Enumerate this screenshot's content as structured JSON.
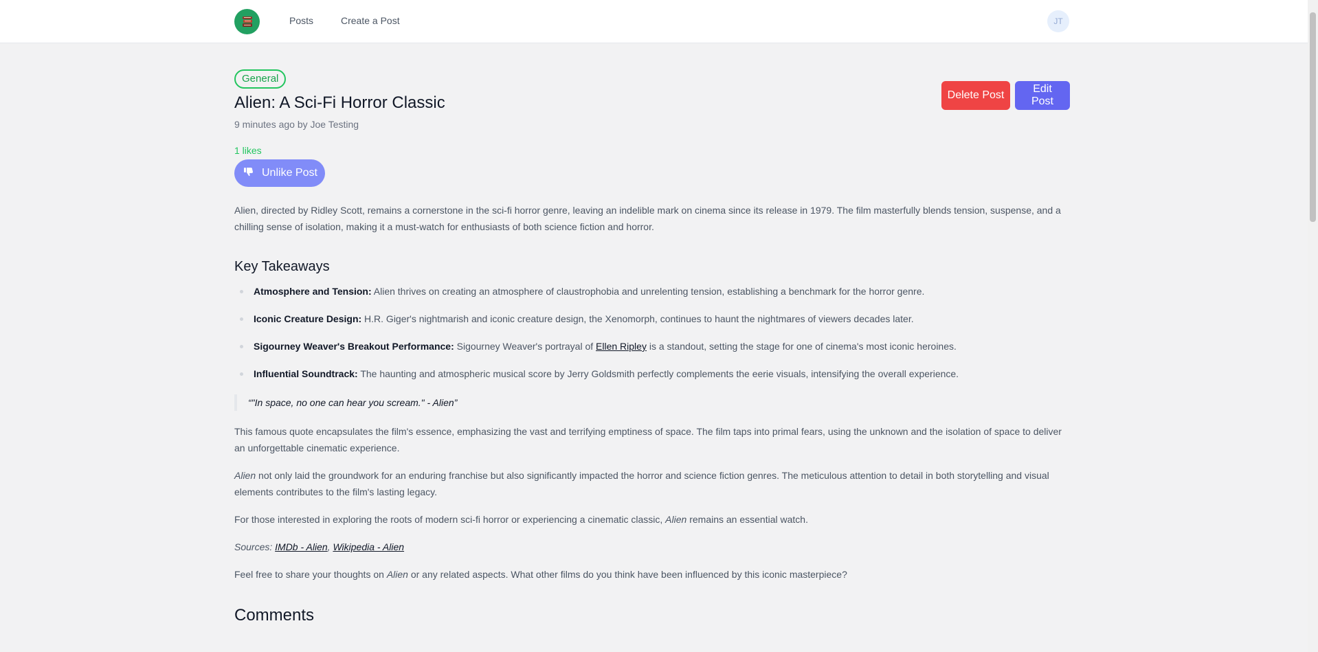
{
  "nav": {
    "logo_icon": "book-stack-icon",
    "links": [
      "Posts",
      "Create a Post"
    ],
    "avatar_initials": "JT"
  },
  "post": {
    "category": "General",
    "title": "Alien: A Sci-Fi Horror Classic",
    "meta": "9 minutes ago by Joe Testing",
    "delete_label": "Delete Post",
    "edit_label": "Edit Post",
    "likes": "1 likes",
    "unlike_label": "Unlike Post"
  },
  "article": {
    "intro": "Alien, directed by Ridley Scott, remains a cornerstone in the sci-fi horror genre, leaving an indelible mark on cinema since its release in 1979. The film masterfully blends tension, suspense, and a chilling sense of isolation, making it a must-watch for enthusiasts of both science fiction and horror.",
    "takeaways_heading": "Key Takeaways",
    "takeaways": [
      {
        "term": "Atmosphere and Tension:",
        "text": " Alien thrives on creating an atmosphere of claustrophobia and unrelenting tension, establishing a benchmark for the horror genre."
      },
      {
        "term": "Iconic Creature Design:",
        "text": " H.R. Giger's nightmarish and iconic creature design, the Xenomorph, continues to haunt the nightmares of viewers decades later."
      },
      {
        "term": "Sigourney Weaver's Breakout Performance:",
        "text_before": " Sigourney Weaver's portrayal of ",
        "link": "Ellen Ripley",
        "text_after": " is a standout, setting the stage for one of cinema's most iconic heroines."
      },
      {
        "term": "Influential Soundtrack:",
        "text": " The haunting and atmospheric musical score by Jerry Goldsmith perfectly complements the eerie visuals, intensifying the overall experience."
      }
    ],
    "quote": "“\"In space, no one can hear you scream.\" - Alien”",
    "para_quote": "This famous quote encapsulates the film's essence, emphasizing the vast and terrifying emptiness of space. The film taps into primal fears, using the unknown and the isolation of space to deliver an unforgettable cinematic experience.",
    "para_legacy_em": "Alien",
    "para_legacy": " not only laid the groundwork for an enduring franchise but also significantly impacted the horror and science fiction genres. The meticulous attention to detail in both storytelling and visual elements contributes to the film's lasting legacy.",
    "para_watch_before": "For those interested in exploring the roots of modern sci-fi horror or experiencing a cinematic classic, ",
    "para_watch_em": "Alien",
    "para_watch_after": " remains an essential watch.",
    "sources_label": "Sources: ",
    "source_1": "IMDb - Alien",
    "sources_sep": ", ",
    "source_2": "Wikipedia - Alien",
    "para_share_before": "Feel free to share your thoughts on ",
    "para_share_em": "Alien",
    "para_share_after": " or any related aspects. What other films do you think have been influenced by this iconic masterpiece?"
  },
  "comments_heading": "Comments",
  "colors": {
    "accent_green": "#22c55e",
    "delete_red": "#ef4444",
    "edit_indigo": "#6366f1",
    "unlike_indigo": "#818cf8"
  }
}
